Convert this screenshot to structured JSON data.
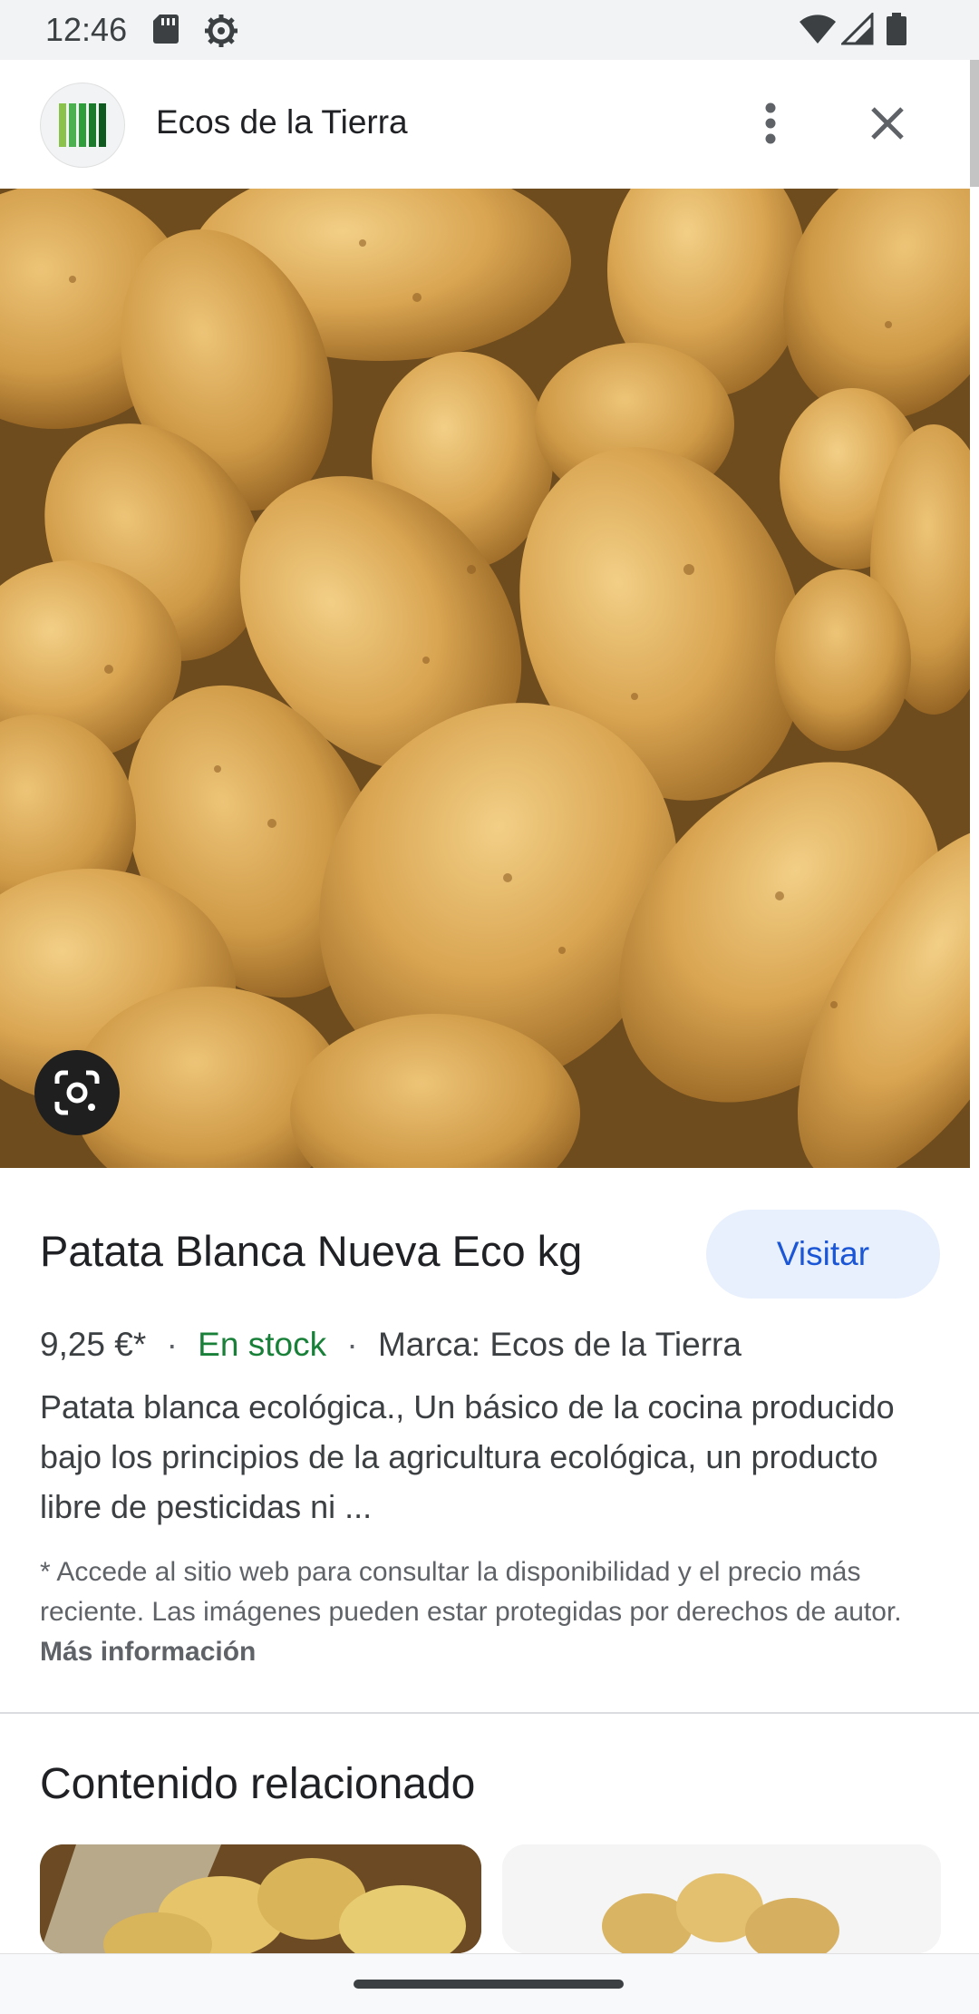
{
  "status_bar": {
    "time": "12:46",
    "icons_left": [
      "sd-card-icon",
      "settings-icon"
    ],
    "icons_right": [
      "wifi-icon",
      "signal-icon",
      "battery-icon"
    ]
  },
  "header": {
    "logo_icon": "brand-stripes-icon",
    "title": "Ecos de la Tierra",
    "more_icon": "more-vert-icon",
    "close_icon": "close-icon"
  },
  "hero": {
    "lens_icon": "google-lens-icon"
  },
  "product": {
    "title": "Patata Blanca Nueva Eco kg",
    "visit_label": "Visitar",
    "price": "9,25 €*",
    "stock": "En stock",
    "brand": "Marca: Ecos de la Tierra",
    "description": "Patata blanca ecológica., Un básico de la cocina producido bajo los principios de la agricultura ecológica, un producto libre de pesticidas ni ...",
    "disclaimer": "* Accede al sitio web para consultar la disponibilidad y el precio más reciente. Las imágenes pueden estar protegidas por derechos de autor.",
    "more_info": "Más información"
  },
  "related": {
    "title": "Contenido relacionado"
  },
  "colors": {
    "accent": "#1a56d6",
    "button_bg": "#e8f0fe",
    "stock_green": "#188038",
    "logo_green": "#2e9e3a"
  }
}
